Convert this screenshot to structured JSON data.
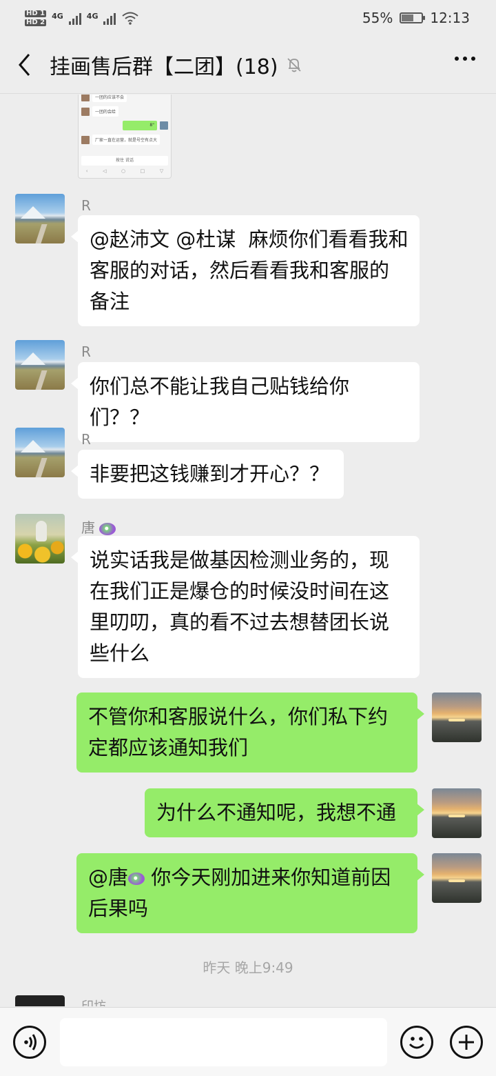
{
  "status_bar": {
    "hd1": "HD 1",
    "hd2": "HD 2",
    "network1": "4G",
    "network2": "4G",
    "battery": "55%",
    "time": "12:13"
  },
  "header": {
    "title": "挂画售后群【二团】(18)",
    "back_icon": "chevron-left-icon",
    "mute_icon": "bell-off-icon",
    "more_icon": "more-horizontal-icon"
  },
  "screenshot_preview": {
    "row1": "一团的应该不会",
    "row2": "一团的会给",
    "green_label": "8\"",
    "row3": "厂家一直在运营，就是号空有点大",
    "input_hint": "按住 说话"
  },
  "messages": [
    {
      "sender": "R",
      "side": "left",
      "text": "@赵沛文 @杜谋  麻烦你们看看我和客服的对话，然后看看我和客服的备注"
    },
    {
      "sender": "R",
      "side": "left",
      "text": "你们总不能让我自己贴钱给你们？？"
    },
    {
      "sender": "R",
      "side": "left",
      "text": "非要把这钱赚到才开心？？"
    },
    {
      "sender": "唐",
      "side": "left",
      "text": "说实话我是做基因检测业务的，现在我们正是爆仓的时候没时间在这里叨叨，真的看不过去想替团长说些什么"
    },
    {
      "side": "right",
      "text": "不管你和客服说什么，你们私下约定都应该通知我们"
    },
    {
      "side": "right",
      "text": "为什么不通知呢，我想不通"
    },
    {
      "side": "right",
      "text": "@唐",
      "suffix": " 你今天刚加进来你知道前因后果吗"
    }
  ],
  "timestamp": "昨天 晚上9:49",
  "partial_sender": "印坊",
  "input_bar": {
    "placeholder": "",
    "voice_icon": "voice-icon",
    "emoji_icon": "emoji-icon",
    "plus_icon": "plus-circle-icon"
  }
}
